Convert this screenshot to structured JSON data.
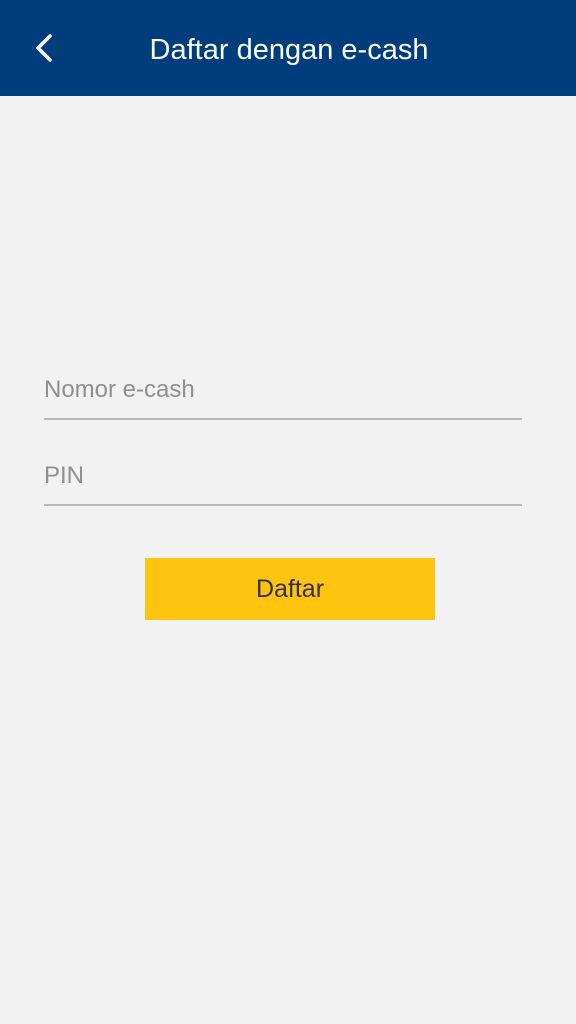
{
  "app_bar": {
    "title": "Daftar dengan e-cash",
    "back_icon": "chevron-left-icon",
    "background_color": "#003d7c"
  },
  "form": {
    "ecash_number": {
      "value": "",
      "placeholder": "Nomor e-cash"
    },
    "pin": {
      "value": "",
      "placeholder": "PIN"
    },
    "submit_label": "Daftar",
    "submit_color": "#ffc40f"
  }
}
